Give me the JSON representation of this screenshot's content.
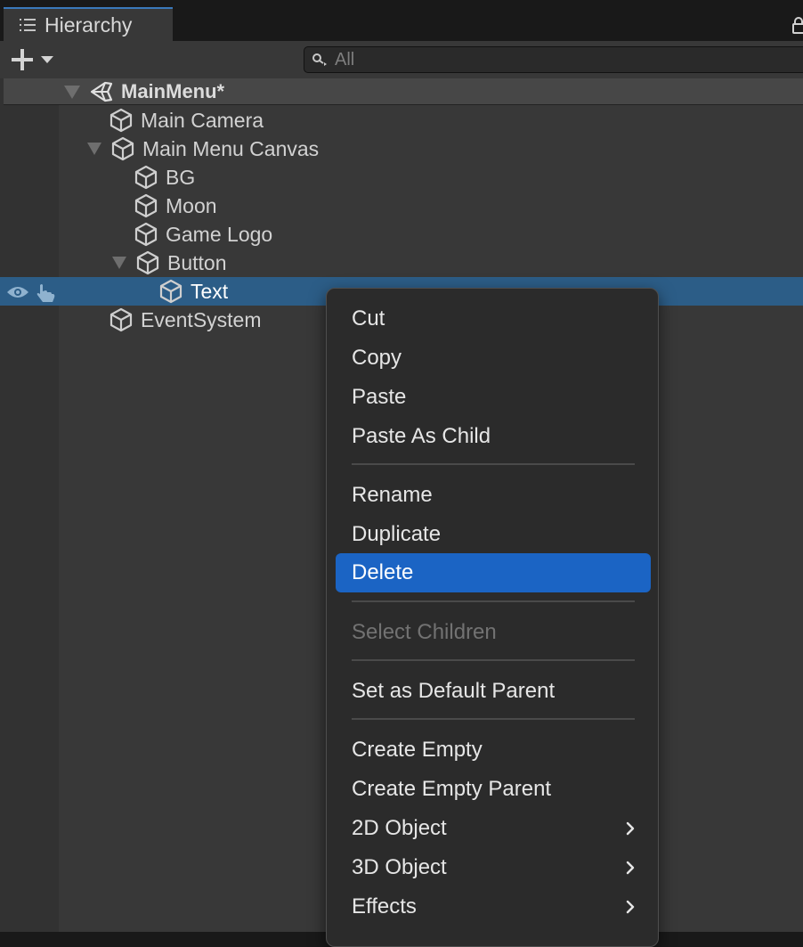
{
  "tab": {
    "label": "Hierarchy"
  },
  "search": {
    "placeholder": "All"
  },
  "scene": {
    "label": "MainMenu*"
  },
  "tree": [
    {
      "label": "Main Camera"
    },
    {
      "label": "Main Menu Canvas"
    },
    {
      "label": "BG"
    },
    {
      "label": "Moon"
    },
    {
      "label": "Game Logo"
    },
    {
      "label": "Button"
    },
    {
      "label": "Text"
    },
    {
      "label": "EventSystem"
    }
  ],
  "context_menu": {
    "items": [
      {
        "label": "Cut"
      },
      {
        "label": "Copy"
      },
      {
        "label": "Paste"
      },
      {
        "label": "Paste As Child"
      },
      {
        "label": "Rename"
      },
      {
        "label": "Duplicate"
      },
      {
        "label": "Delete"
      },
      {
        "label": "Select Children"
      },
      {
        "label": "Set as Default Parent"
      },
      {
        "label": "Create Empty"
      },
      {
        "label": "Create Empty Parent"
      },
      {
        "label": "2D Object"
      },
      {
        "label": "3D Object"
      },
      {
        "label": "Effects"
      }
    ],
    "highlighted": "Delete",
    "disabled": [
      "Select Children"
    ],
    "submenu_items": [
      "2D Object",
      "3D Object",
      "Effects"
    ]
  },
  "icons": {
    "tab": "list-icon",
    "lock": "lock-icon",
    "add": "plus-icon",
    "dropdown": "caret-down-icon",
    "search": "search-icon",
    "scene": "unity-logo-icon",
    "gameobject": "cube-icon",
    "visibility": "eye-icon",
    "pickable": "hand-icon",
    "submenu": "chevron-right-icon"
  },
  "colors": {
    "selection": "#2c5d87",
    "menu_highlight": "#1b64c4",
    "tab_accent": "#3a79bb"
  }
}
